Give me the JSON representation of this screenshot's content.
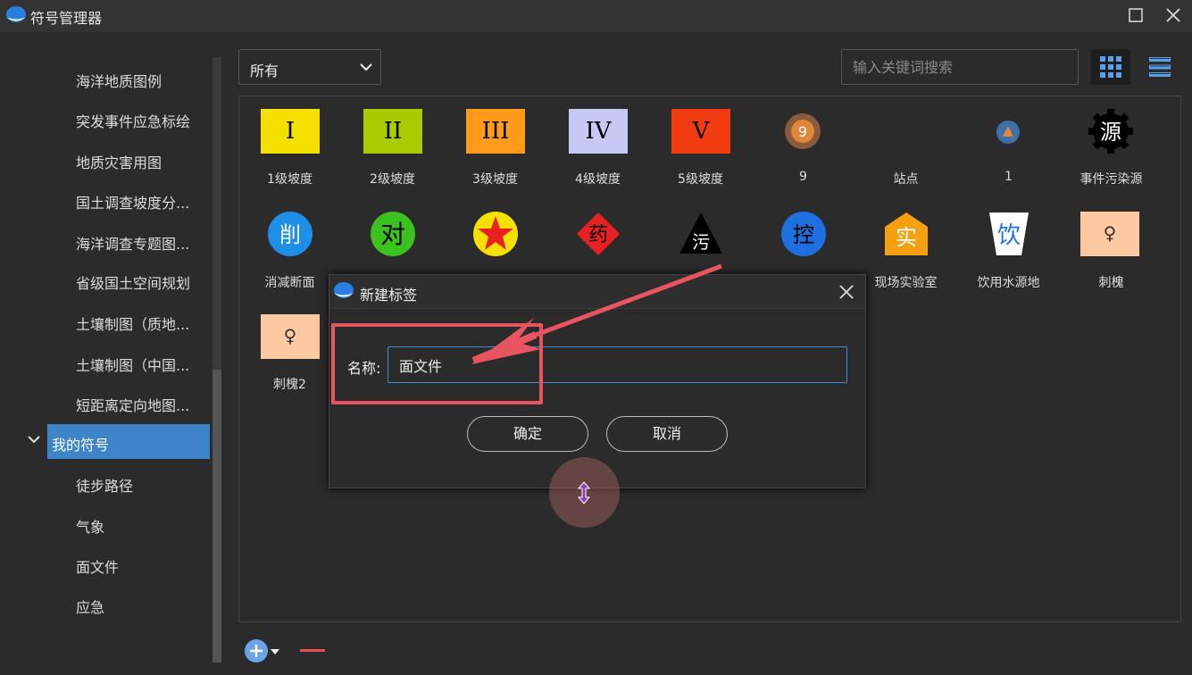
{
  "window": {
    "title": "符号管理器",
    "maximize_icon": "maximize-icon",
    "close_icon": "close-icon"
  },
  "sidebar": {
    "items": [
      {
        "label": "海洋地质图例"
      },
      {
        "label": "突发事件应急标绘"
      },
      {
        "label": "地质灾害用图"
      },
      {
        "label": "国土调查坡度分..."
      },
      {
        "label": "海洋调查专题图..."
      },
      {
        "label": "省级国土空间规划"
      },
      {
        "label": "土壤制图（质地..."
      },
      {
        "label": "土壤制图（中国..."
      },
      {
        "label": "短距离定向地图..."
      }
    ],
    "selected": {
      "label": "我的符号",
      "expanded": true
    },
    "children": [
      {
        "label": "徒步路径"
      },
      {
        "label": "气象"
      },
      {
        "label": "面文件"
      },
      {
        "label": "应急"
      }
    ]
  },
  "toolbar": {
    "filter_value": "所有",
    "search_placeholder": "输入关键词搜索",
    "view_mode": "grid"
  },
  "symbols": [
    {
      "label": "1级坡度",
      "glyph": "I",
      "color": "#f5e000"
    },
    {
      "label": "2级坡度",
      "glyph": "II",
      "color": "#a8cc00"
    },
    {
      "label": "3级坡度",
      "glyph": "III",
      "color": "#ff9a1a"
    },
    {
      "label": "4级坡度",
      "glyph": "IV",
      "color": "#c8c8f5"
    },
    {
      "label": "5级坡度",
      "glyph": "V",
      "color": "#f03c10"
    },
    {
      "label": "9",
      "glyph": "9",
      "color": "#e0873a"
    },
    {
      "label": "站点",
      "glyph": "",
      "color": "#2b2b2b"
    },
    {
      "label": "1",
      "glyph": "",
      "color": "#3d6fa8"
    },
    {
      "label": "事件污染源",
      "glyph": "源",
      "color": "#000000"
    },
    {
      "label": "消减断面",
      "glyph": "削",
      "color": "#1e8fe6"
    },
    {
      "label": "",
      "glyph": "对",
      "color": "#3cc21e"
    },
    {
      "label": "",
      "glyph": "",
      "color": "#f5e000"
    },
    {
      "label": "",
      "glyph": "药",
      "color": "#e82020"
    },
    {
      "label": "",
      "glyph": "污",
      "color": "#000000"
    },
    {
      "label": "",
      "glyph": "控",
      "color": "#1e6fe0"
    },
    {
      "label": "现场实验室",
      "glyph": "实",
      "color": "#f5a010"
    },
    {
      "label": "饮用水源地",
      "glyph": "饮",
      "color": "#ffffff"
    },
    {
      "label": "刺槐",
      "glyph": "♀",
      "color": "#fdc9a0"
    },
    {
      "label": "刺槐2",
      "glyph": "♀",
      "color": "#fdc9a0"
    }
  ],
  "dialog": {
    "title": "新建标签",
    "name_label": "名称:",
    "name_value": "面文件",
    "ok_label": "确定",
    "cancel_label": "取消"
  }
}
